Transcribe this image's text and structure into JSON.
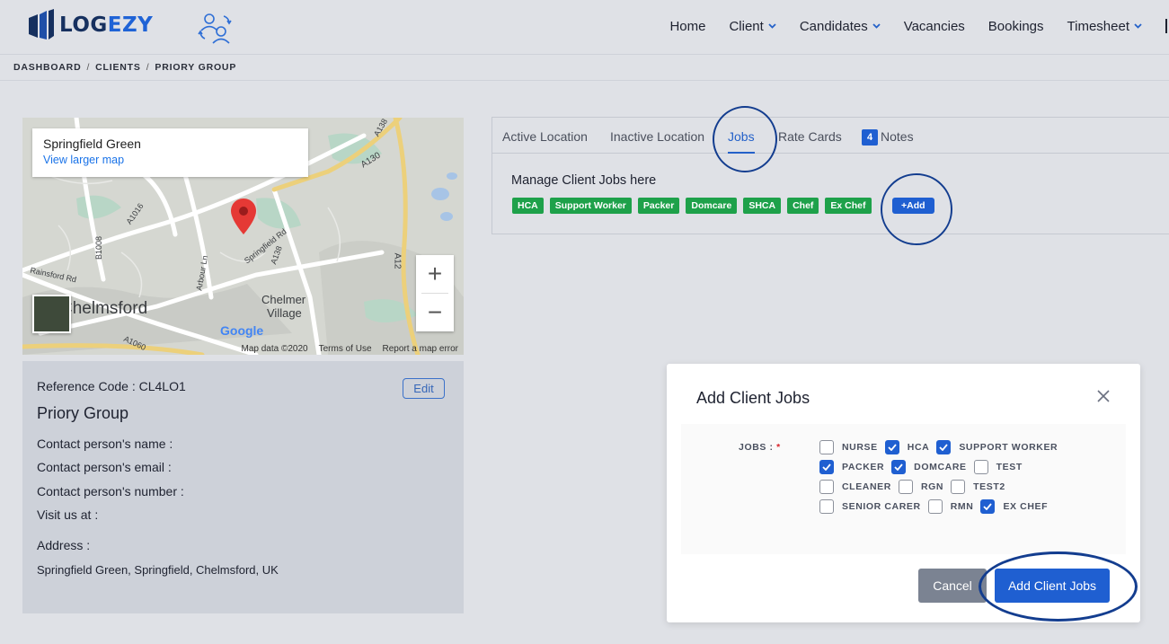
{
  "header": {
    "logo_text_a": "LOG",
    "logo_text_b": "EZY",
    "nav": [
      {
        "label": "Home",
        "dropdown": false
      },
      {
        "label": "Client",
        "dropdown": true
      },
      {
        "label": "Candidates",
        "dropdown": true
      },
      {
        "label": "Vacancies",
        "dropdown": false
      },
      {
        "label": "Bookings",
        "dropdown": false
      },
      {
        "label": "Timesheet",
        "dropdown": true
      }
    ]
  },
  "breadcrumb": [
    "DASHBOARD",
    "CLIENTS",
    "PRIORY GROUP"
  ],
  "breadcrumb_sep": "/",
  "map": {
    "place_title": "Springfield Green",
    "view_larger_link": "View larger map",
    "labels": {
      "chelmsford": "Chelmsford",
      "chelmer": "Chelmer",
      "village": "Village",
      "a130": "A130",
      "a138": "A138",
      "a12": "A12",
      "a1016": "A1016",
      "b1008": "B1008",
      "springfield_rd": "Springfield Rd",
      "arbour_ln": "Arbour Ln",
      "rainsford_rd": "Rainsford Rd",
      "a1060": "A1060",
      "a138_top": "A138"
    },
    "zoom_in": "+",
    "zoom_out": "−",
    "google": "Google",
    "footer": {
      "data": "Map data ©2020",
      "terms": "Terms of Use",
      "report": "Report a map error"
    }
  },
  "client": {
    "reference_code": "Reference Code : CL4LO1",
    "edit_label": "Edit",
    "name": "Priory Group",
    "contact_name": "Contact person's name :",
    "contact_email": "Contact person's email :",
    "contact_number": "Contact person's number :",
    "visit": "Visit us at :",
    "address_label": "Address :",
    "address": "Springfield Green, Springfield, Chelmsford, UK"
  },
  "tabs": {
    "active_location": "Active Location",
    "inactive_location": "Inactive Location",
    "jobs": "Jobs",
    "rate_cards": "Rate Cards",
    "notes_count": "4",
    "notes": "Notes"
  },
  "jobs_panel": {
    "heading": "Manage Client Jobs here",
    "chips": [
      "HCA",
      "Support Worker",
      "Packer",
      "Domcare",
      "SHCA",
      "Chef",
      "Ex Chef"
    ],
    "add_label": "+Add"
  },
  "modal": {
    "title": "Add Client Jobs",
    "jobs_label": "JOBS :",
    "required_mark": "*",
    "rows": [
      [
        {
          "label": "NURSE",
          "checked": false
        },
        {
          "label": "HCA",
          "checked": true
        },
        {
          "label": "SUPPORT WORKER",
          "checked": true
        }
      ],
      [
        {
          "label": "PACKER",
          "checked": true
        },
        {
          "label": "DOMCARE",
          "checked": true
        },
        {
          "label": "TEST",
          "checked": false
        }
      ],
      [
        {
          "label": "CLEANER",
          "checked": false
        },
        {
          "label": "RGN",
          "checked": false
        },
        {
          "label": "TEST2",
          "checked": false
        }
      ],
      [
        {
          "label": "SENIOR CARER",
          "checked": false
        },
        {
          "label": "RMN",
          "checked": false
        },
        {
          "label": "EX CHEF",
          "checked": true
        }
      ]
    ],
    "cancel_label": "Cancel",
    "submit_label": "Add Client Jobs"
  },
  "colors": {
    "primary": "#1f5fd1",
    "chip_green": "#1ea14a",
    "annotation_ring": "#133d8f",
    "pin_red": "#e53935"
  }
}
